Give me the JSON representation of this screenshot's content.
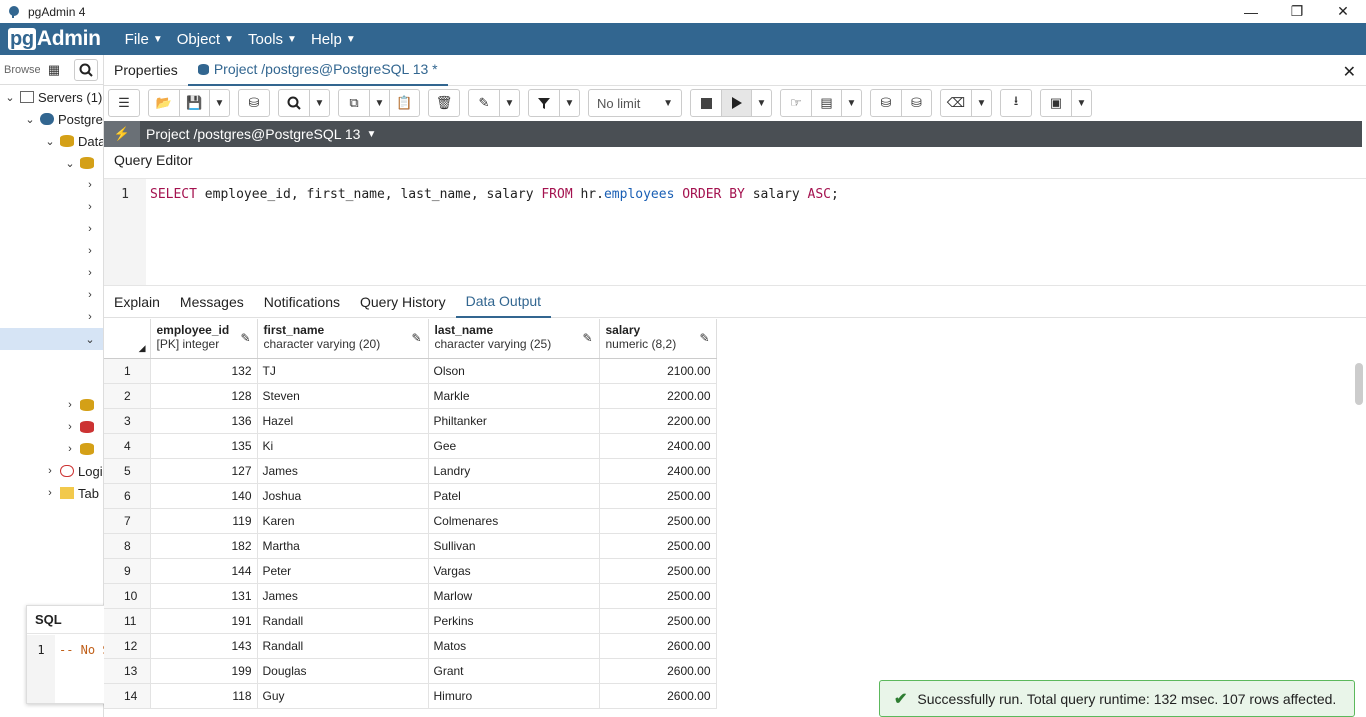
{
  "window": {
    "title": "pgAdmin 4"
  },
  "menubar": {
    "logo_pg": "pg",
    "logo_rest": "Admin",
    "menus": [
      "File",
      "Object",
      "Tools",
      "Help"
    ]
  },
  "tree": {
    "browser_label": "Browser",
    "items": [
      {
        "label": "Servers (1)"
      },
      {
        "label": "Postgre"
      },
      {
        "label": "Data"
      },
      {
        "label": "Logi"
      },
      {
        "label": "Tab"
      }
    ]
  },
  "tabs": {
    "properties": "Properties",
    "project": "Project /postgres@PostgreSQL 13 *"
  },
  "toolbar": {
    "limit_value": "No limit"
  },
  "project_bar": {
    "title": "Project /postgres@PostgreSQL 13"
  },
  "query_editor": {
    "title": "Query Editor",
    "line": "1"
  },
  "result_tabs": [
    "Explain",
    "Messages",
    "Notifications",
    "Query History",
    "Data Output"
  ],
  "grid": {
    "columns": [
      {
        "name": "employee_id",
        "type": "[PK] integer"
      },
      {
        "name": "first_name",
        "type": "character varying (20)"
      },
      {
        "name": "last_name",
        "type": "character varying (25)"
      },
      {
        "name": "salary",
        "type": "numeric (8,2)"
      }
    ],
    "rows": [
      {
        "n": "1",
        "id": "132",
        "first": "TJ",
        "last": "Olson",
        "salary": "2100.00"
      },
      {
        "n": "2",
        "id": "128",
        "first": "Steven",
        "last": "Markle",
        "salary": "2200.00"
      },
      {
        "n": "3",
        "id": "136",
        "first": "Hazel",
        "last": "Philtanker",
        "salary": "2200.00"
      },
      {
        "n": "4",
        "id": "135",
        "first": "Ki",
        "last": "Gee",
        "salary": "2400.00"
      },
      {
        "n": "5",
        "id": "127",
        "first": "James",
        "last": "Landry",
        "salary": "2400.00"
      },
      {
        "n": "6",
        "id": "140",
        "first": "Joshua",
        "last": "Patel",
        "salary": "2500.00"
      },
      {
        "n": "7",
        "id": "119",
        "first": "Karen",
        "last": "Colmenares",
        "salary": "2500.00"
      },
      {
        "n": "8",
        "id": "182",
        "first": "Martha",
        "last": "Sullivan",
        "salary": "2500.00"
      },
      {
        "n": "9",
        "id": "144",
        "first": "Peter",
        "last": "Vargas",
        "salary": "2500.00"
      },
      {
        "n": "10",
        "id": "131",
        "first": "James",
        "last": "Marlow",
        "salary": "2500.00"
      },
      {
        "n": "11",
        "id": "191",
        "first": "Randall",
        "last": "Perkins",
        "salary": "2500.00"
      },
      {
        "n": "12",
        "id": "143",
        "first": "Randall",
        "last": "Matos",
        "salary": "2600.00"
      },
      {
        "n": "13",
        "id": "199",
        "first": "Douglas",
        "last": "Grant",
        "salary": "2600.00"
      },
      {
        "n": "14",
        "id": "118",
        "first": "Guy",
        "last": "Himuro",
        "salary": "2600.00"
      }
    ]
  },
  "toast": {
    "message": "Successfully run. Total query runtime: 132 msec. 107 rows affected."
  },
  "sql_panel": {
    "title": "SQL",
    "line": "1",
    "code": "-- No SQL"
  },
  "colors": {
    "brand": "#326690",
    "toast_border": "#5cb85c"
  }
}
